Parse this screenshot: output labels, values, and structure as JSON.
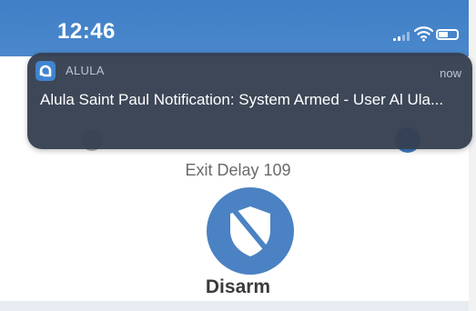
{
  "status_bar": {
    "time": "12:46",
    "icons": [
      "signal-icon",
      "wifi-icon",
      "battery-icon"
    ]
  },
  "notification": {
    "app_icon": "alula-logo-icon",
    "app_name": "ALULA",
    "time": "now",
    "message": "Alula Saint Paul Notification: System Armed - User Al Ula..."
  },
  "security_panel": {
    "exit_delay_text": "Exit Delay 109",
    "disarm_icon": "shield-slash-icon",
    "disarm_label": "Disarm"
  },
  "colors": {
    "status_bar": "#4583c9",
    "notification_bg": "#354050",
    "disarm_button": "#4b82c3",
    "accent_blue": "#3d7cc2"
  }
}
